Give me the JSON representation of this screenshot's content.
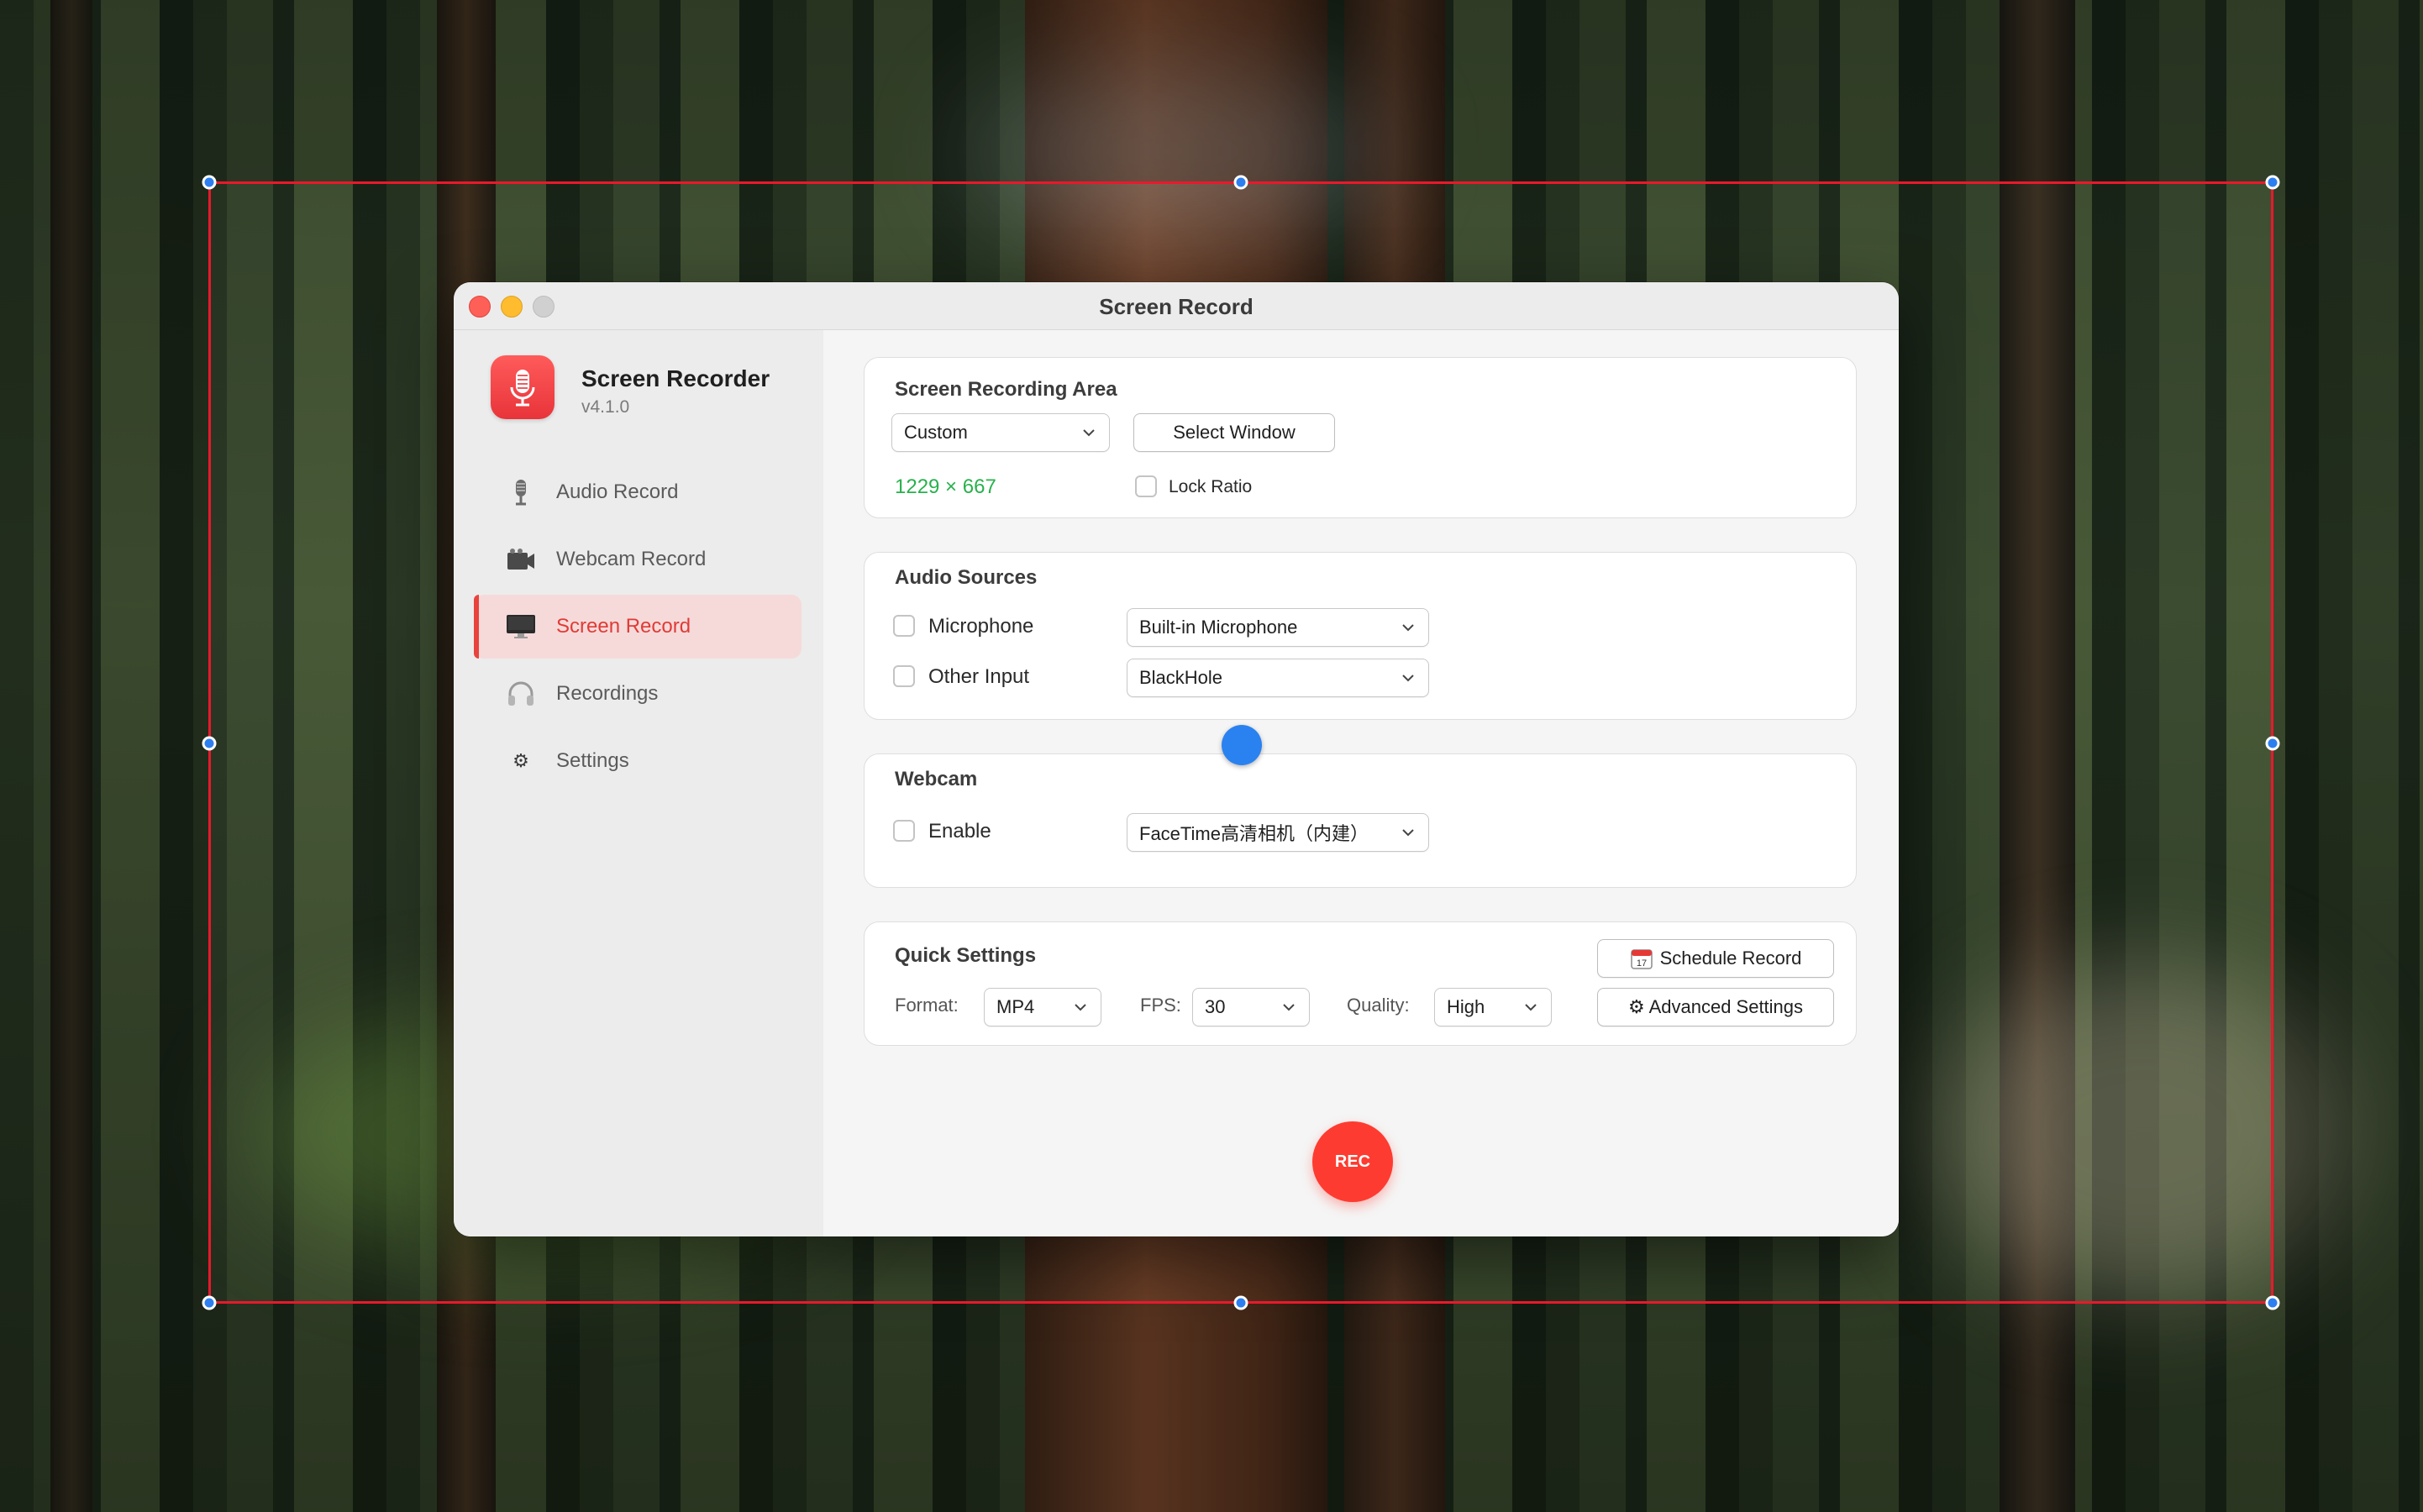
{
  "window": {
    "title": "Screen Record"
  },
  "app": {
    "name": "Screen Recorder",
    "version": "v4.1.0"
  },
  "sidebar": {
    "items": [
      {
        "label": "Audio Record",
        "icon": "microphone-icon"
      },
      {
        "label": "Webcam Record",
        "icon": "video-camera-icon"
      },
      {
        "label": "Screen Record",
        "icon": "monitor-icon",
        "active": true
      },
      {
        "label": "Recordings",
        "icon": "headphones-icon"
      },
      {
        "label": "Settings",
        "icon": "gear-icon"
      }
    ]
  },
  "recording_area": {
    "title": "Screen Recording Area",
    "mode": "Custom",
    "select_window_label": "Select Window",
    "dimensions": "1229 × 667",
    "lock_ratio_label": "Lock Ratio"
  },
  "audio_sources": {
    "title": "Audio Sources",
    "microphone_label": "Microphone",
    "microphone_device": "Built-in Microphone",
    "other_input_label": "Other Input",
    "other_input_device": "BlackHole"
  },
  "webcam": {
    "title": "Webcam",
    "enable_label": "Enable",
    "device": "FaceTime高清相机（内建）"
  },
  "quick_settings": {
    "title": "Quick Settings",
    "format_label": "Format:",
    "format_value": "MP4",
    "fps_label": "FPS:",
    "fps_value": "30",
    "quality_label": "Quality:",
    "quality_value": "High",
    "schedule_label": "Schedule Record",
    "advanced_label": "⚙ Advanced Settings"
  },
  "rec_label": "REC",
  "colors": {
    "accent_red": "#e8433d",
    "selection_frame": "#e8192c",
    "handle_blue": "#2d7ff0",
    "dimension_green": "#28b14c"
  }
}
